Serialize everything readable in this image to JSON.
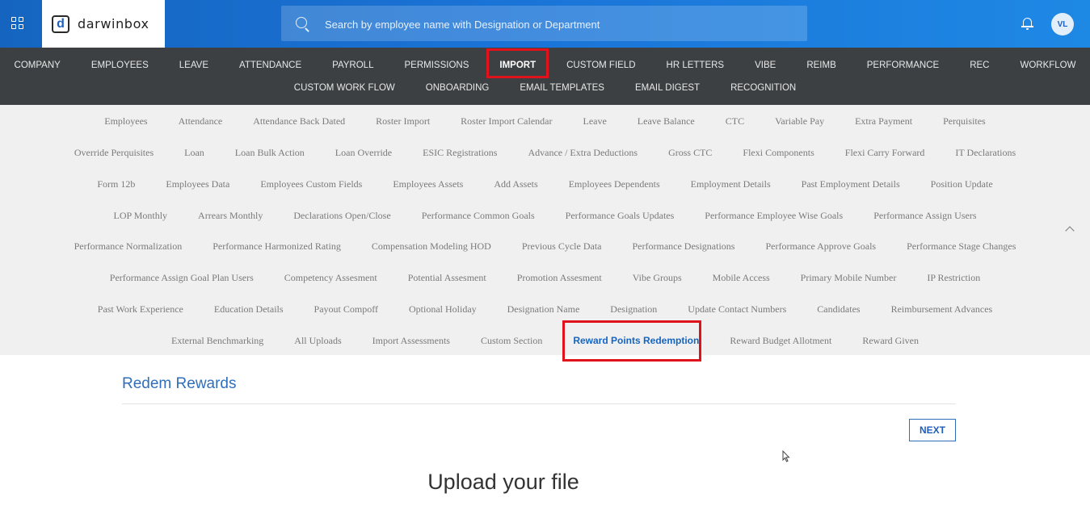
{
  "header": {
    "brand": "darwinbox",
    "search_placeholder": "Search by employee name with Designation or Department",
    "avatar_initials": "VL"
  },
  "main_nav": {
    "row1": [
      "COMPANY",
      "EMPLOYEES",
      "LEAVE",
      "ATTENDANCE",
      "PAYROLL",
      "PERMISSIONS",
      "IMPORT",
      "CUSTOM FIELD",
      "HR LETTERS",
      "VIBE",
      "REIMB",
      "PERFORMANCE",
      "REC",
      "WORKFLOW"
    ],
    "row2": [
      "CUSTOM WORK FLOW",
      "ONBOARDING",
      "EMAIL TEMPLATES",
      "EMAIL DIGEST",
      "RECOGNITION"
    ],
    "active": "IMPORT"
  },
  "sub_nav": {
    "rows": [
      [
        "Employees",
        "Attendance",
        "Attendance Back Dated",
        "Roster Import",
        "Roster Import Calendar",
        "Leave",
        "Leave Balance",
        "CTC",
        "Variable Pay",
        "Extra Payment",
        "Perquisites"
      ],
      [
        "Override Perquisites",
        "Loan",
        "Loan Bulk Action",
        "Loan Override",
        "ESIC Registrations",
        "Advance / Extra Deductions",
        "Gross CTC",
        "Flexi Components",
        "Flexi Carry Forward",
        "IT Declarations"
      ],
      [
        "Form 12b",
        "Employees Data",
        "Employees Custom Fields",
        "Employees Assets",
        "Add Assets",
        "Employees Dependents",
        "Employment Details",
        "Past Employment Details",
        "Position Update"
      ],
      [
        "LOP Monthly",
        "Arrears Monthly",
        "Declarations Open/Close",
        "Performance Common Goals",
        "Performance Goals Updates",
        "Performance Employee Wise Goals",
        "Performance Assign Users"
      ],
      [
        "Performance Normalization",
        "Performance Harmonized Rating",
        "Compensation Modeling HOD",
        "Previous Cycle Data",
        "Performance Designations",
        "Performance Approve Goals",
        "Performance Stage Changes"
      ],
      [
        "Performance Assign Goal Plan Users",
        "Competency Assesment",
        "Potential Assesment",
        "Promotion Assesment",
        "Vibe Groups",
        "Mobile Access",
        "Primary Mobile Number",
        "IP Restriction"
      ],
      [
        "Past Work Experience",
        "Education Details",
        "Payout Compoff",
        "Optional Holiday",
        "Designation Name",
        "Designation",
        "Update Contact Numbers",
        "Candidates",
        "Reimbursement Advances"
      ],
      [
        "External Benchmarking",
        "All Uploads",
        "Import Assessments",
        "Custom Section",
        "Reward Points Redemption",
        "Reward Budget Allotment",
        "Reward Given"
      ]
    ],
    "active": "Reward Points Redemption"
  },
  "content": {
    "page_title": "Redem Rewards",
    "next_label": "NEXT",
    "upload_title": "Upload your file"
  },
  "colors": {
    "topbar": "#1a73d6",
    "nav_bg": "#3c4043",
    "subnav_bg": "#f0f0f0",
    "highlight": "#e0131c",
    "accent": "#2f6fba"
  }
}
